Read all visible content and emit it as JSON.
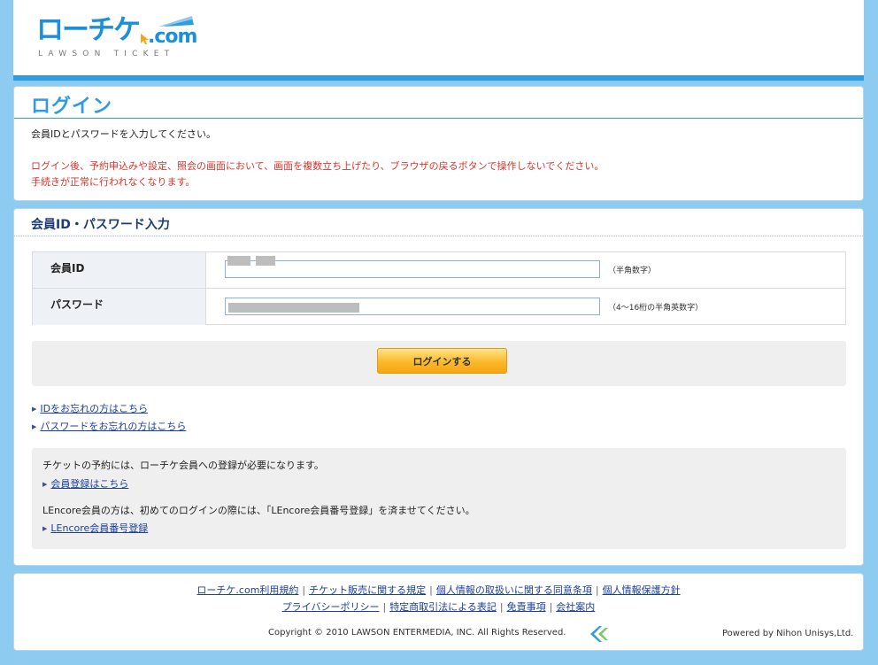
{
  "header": {
    "logo_main": "ローチケ",
    "logo_com": ".com",
    "logo_sub": "LAWSON TICKET"
  },
  "login_panel": {
    "title": "ログイン",
    "intro": "会員IDとパスワードを入力してください。",
    "warning_line1": "ログイン後、予約申込みや設定、照会の画面において、画面を複数立ち上げたり、ブラウザの戻るボタンで操作しないでください。",
    "warning_line2": "手続きが正常に行われなくなります。"
  },
  "form_panel": {
    "title": "会員ID・パスワード入力",
    "member_id": {
      "label": "会員ID",
      "value": "",
      "hint": "（半角数字）"
    },
    "password": {
      "label": "パスワード",
      "value": "",
      "hint": "（4～16桁の半角英数字）"
    },
    "login_button": "ログインする",
    "forgot_id": "IDをお忘れの方はこちら",
    "forgot_password": "パスワードをお忘れの方はこちら",
    "info": {
      "register_text": "チケットの予約には、ローチケ会員への登録が必要になります。",
      "register_link": "会員登録はこちら",
      "lencore_text": "LEncore会員の方は、初めてのログインの際には、「LEncore会員番号登録」を済ませてください。",
      "lencore_link": "LEncore会員番号登録"
    }
  },
  "footer": {
    "links_row1": [
      "ローチケ.com利用規約",
      "チケット販売に関する規定",
      "個人情報の取扱いに関する同意条項",
      "個人情報保護方針"
    ],
    "links_row2": [
      "プライバシーポリシー",
      "特定商取引法による表記",
      "免責事項",
      "会社案内"
    ],
    "copyright": "Copyright © 2010 LAWSON ENTERMEDIA, INC. All Rights Reserved.",
    "powered_by": "Powered by Nihon Unisys,Ltd."
  },
  "colors": {
    "page_bg": "#8ecbf0",
    "accent_blue": "#2f9be4",
    "warning_red": "#d8352c",
    "link_blue": "#1a3f9c",
    "button_orange": "#fbb92a"
  }
}
